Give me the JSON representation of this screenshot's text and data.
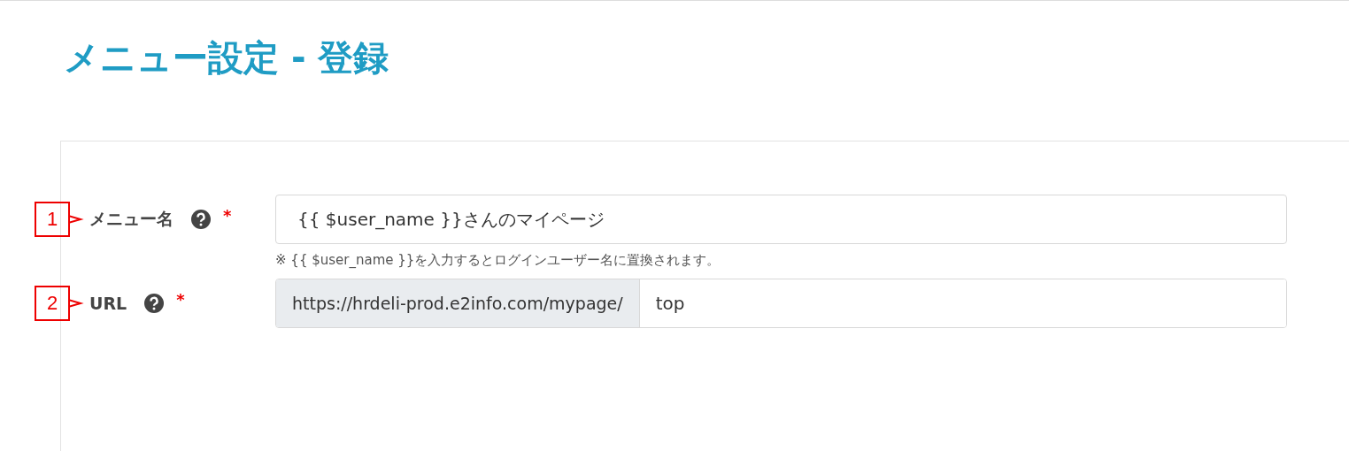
{
  "title": "メニュー設定 - 登録",
  "fields": [
    {
      "callout": "1",
      "label": "メニュー名",
      "required_mark": "*",
      "kind": "text",
      "value": "{{ $user_name }}さんのマイページ",
      "help": "※ {{ $user_name }}を入力するとログインユーザー名に置換されます。"
    },
    {
      "callout": "2",
      "label": "URL",
      "required_mark": "*",
      "kind": "prefixed",
      "prefix": "https://hrdeli-prod.e2info.com/mypage/",
      "value": "top"
    }
  ]
}
